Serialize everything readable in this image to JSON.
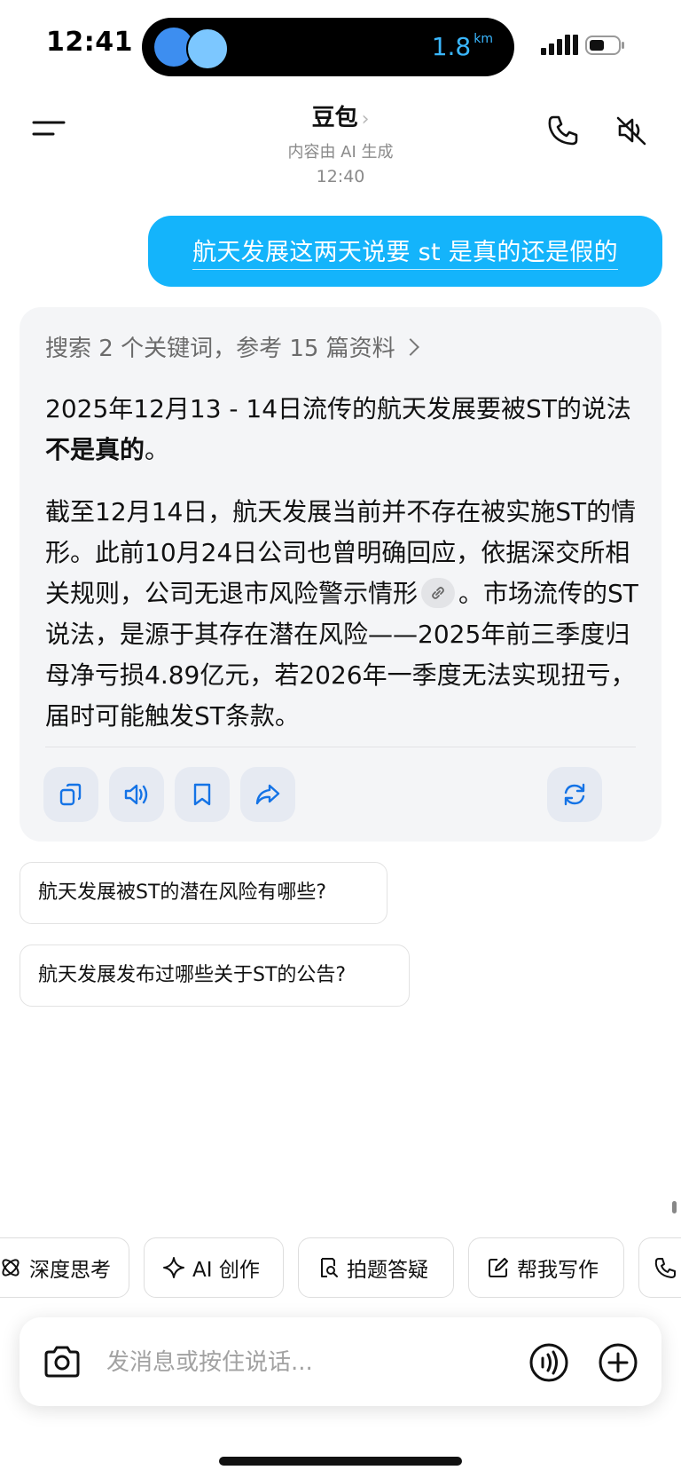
{
  "status_bar": {
    "time": "12:41",
    "distance": "1.8",
    "distance_unit": "km"
  },
  "header": {
    "title": "豆包",
    "subtitle": "内容由 AI 生成",
    "timestamp": "12:40"
  },
  "user_message": "航天发展这两天说要 st 是真的还是假的",
  "ai_response": {
    "search_summary": "搜索 2 个关键词，参考 15 篇资料",
    "para1_prefix": "2025年12月13 - 14日流传的航天发展要被ST的说法",
    "para1_bold": "不是真的",
    "para1_suffix": "。",
    "para2_before_link": "截至12月14日，航天发展当前并不存在被实施ST的情形。此前10月24日公司也曾明确回应，依据深交所相关规则，公司无退市风险警示情形",
    "para2_after_link": "。市场流传的ST说法，是源于其存在潜在风险——2025年前三季度归母净亏损4.89亿元，若2026年一季度无法实现扭亏，届时可能触发ST条款。"
  },
  "actions": [
    "copy-icon",
    "speaker-icon",
    "bookmark-icon",
    "share-icon",
    "regenerate-icon"
  ],
  "suggestions": [
    "航天发展被ST的潜在风险有哪些?",
    "航天发展发布过哪些关于ST的公告?"
  ],
  "tools": [
    {
      "label": "深度思考",
      "icon": "atom-icon"
    },
    {
      "label": "AI 创作",
      "icon": "sparkle-icon"
    },
    {
      "label": "拍题答疑",
      "icon": "search-doc-icon"
    },
    {
      "label": "帮我写作",
      "icon": "edit-icon"
    }
  ],
  "input": {
    "placeholder": "发消息或按住说话..."
  },
  "colors": {
    "accent": "#14b4fb",
    "action_icon": "#1473e6",
    "card_bg": "#f4f5f7"
  }
}
